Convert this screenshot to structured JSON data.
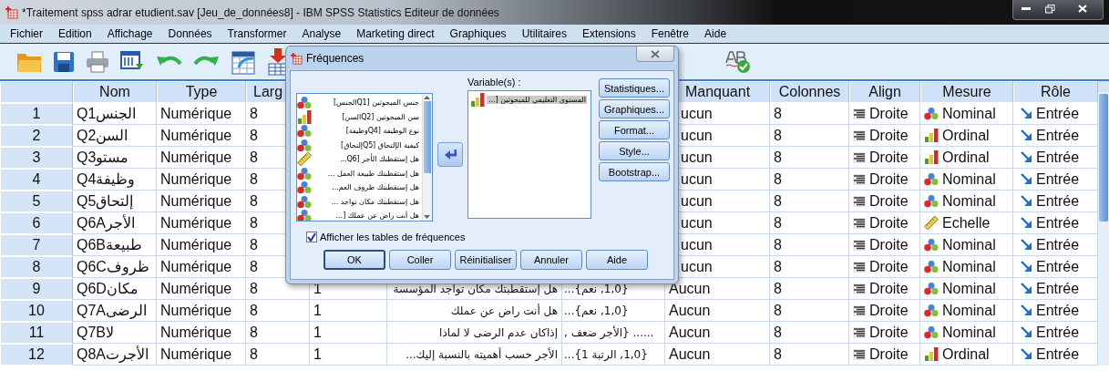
{
  "window": {
    "title": "*Traitement spss adrar etudient.sav [Jeu_de_données8] - IBM SPSS Statistics Editeur de données"
  },
  "menu": [
    "Fichier",
    "Edition",
    "Affichage",
    "Données",
    "Transformer",
    "Analyse",
    "Marketing direct",
    "Graphiques",
    "Utilitaires",
    "Extensions",
    "Fenêtre",
    "Aide"
  ],
  "table": {
    "columns": [
      "Nom",
      "Type",
      "Larg",
      "Manquant",
      "Colonnes",
      "Align",
      "Mesure",
      "Rôle"
    ],
    "rows": [
      {
        "num": "1",
        "nom": "Q1الجنس",
        "type": "Numérique",
        "largeur": "8",
        "manquant": "ucun",
        "colonnes": "8",
        "align": "Droite",
        "mesure": {
          "label": "Nominal",
          "kind": "nominal"
        },
        "role": "Entrée"
      },
      {
        "num": "2",
        "nom": "Q2السن",
        "type": "Numérique",
        "largeur": "8",
        "manquant": "ucun",
        "colonnes": "8",
        "align": "Droite",
        "mesure": {
          "label": "Ordinal",
          "kind": "ordinal"
        },
        "role": "Entrée"
      },
      {
        "num": "3",
        "nom": "Q3مستو",
        "type": "Numérique",
        "largeur": "8",
        "manquant": "ucun",
        "colonnes": "8",
        "align": "Droite",
        "mesure": {
          "label": "Ordinal",
          "kind": "ordinal"
        },
        "role": "Entrée"
      },
      {
        "num": "4",
        "nom": "Q4وظيفة",
        "type": "Numérique",
        "largeur": "8",
        "manquant": "ucun",
        "colonnes": "8",
        "align": "Droite",
        "mesure": {
          "label": "Nominal",
          "kind": "nominal"
        },
        "role": "Entrée"
      },
      {
        "num": "5",
        "nom": "Q5إلتحاق",
        "type": "Numérique",
        "largeur": "8",
        "manquant": "ucun",
        "colonnes": "8",
        "align": "Droite",
        "mesure": {
          "label": "Nominal",
          "kind": "nominal"
        },
        "role": "Entrée"
      },
      {
        "num": "6",
        "nom": "Q6Aالأجر",
        "type": "Numérique",
        "largeur": "8",
        "manquant": "ucun",
        "colonnes": "8",
        "align": "Droite",
        "mesure": {
          "label": "Echelle",
          "kind": "scale"
        },
        "role": "Entrée"
      },
      {
        "num": "7",
        "nom": "Q6Bطبيعة",
        "type": "Numérique",
        "largeur": "8",
        "manquant": "ucun",
        "colonnes": "8",
        "align": "Droite",
        "mesure": {
          "label": "Nominal",
          "kind": "nominal"
        },
        "role": "Entrée"
      },
      {
        "num": "8",
        "nom": "Q6Cظروف",
        "type": "Numérique",
        "largeur": "8",
        "manquant": "ucun",
        "colonnes": "8",
        "align": "Droite",
        "mesure": {
          "label": "Nominal",
          "kind": "nominal"
        },
        "role": "Entrée"
      },
      {
        "num": "9",
        "nom": "Q6Dمكان",
        "type": "Numérique",
        "largeur": "8",
        "decimales": "1",
        "etiquette": "هل إستقطبتك مكان تواجد المؤسسة",
        "valeurs": "{1,0, نعم}...",
        "manquant": "Aucun",
        "colonnes": "8",
        "align": "Droite",
        "mesure": {
          "label": "Nominal",
          "kind": "nominal"
        },
        "role": "Entrée"
      },
      {
        "num": "10",
        "nom": "Q7Aالرضى",
        "type": "Numérique",
        "largeur": "8",
        "decimales": "1",
        "etiquette": "هل أنت راض عن عملك",
        "valeurs": "{1,0, نعم}...",
        "manquant": "Aucun",
        "colonnes": "8",
        "align": "Droite",
        "mesure": {
          "label": "Nominal",
          "kind": "nominal"
        },
        "role": "Entrée"
      },
      {
        "num": "11",
        "nom": "Q7Bلا",
        "type": "Numérique",
        "largeur": "8",
        "decimales": "1",
        "etiquette": "إذاكان عدم الرضى لا لماذا",
        "valeurs": "...... {الأجر ضعف ,",
        "manquant": "Aucun",
        "colonnes": "8",
        "align": "Droite",
        "mesure": {
          "label": "Nominal",
          "kind": "nominal"
        },
        "role": "Entrée"
      },
      {
        "num": "12",
        "nom": "Q8Aالأجرت",
        "type": "Numérique",
        "largeur": "8",
        "decimales": "1",
        "etiquette": "الأجر حسب أهميته بالنسبة إليك...",
        "valeurs": "{1,0, الرتبة 1}...",
        "manquant": "Aucun",
        "colonnes": "8",
        "align": "Droite",
        "mesure": {
          "label": "Ordinal",
          "kind": "ordinal"
        },
        "role": "Entrée"
      }
    ]
  },
  "dialog": {
    "title": "Fréquences",
    "source_list": [
      {
        "label": "جنس المبحوثين [Q1الجنس]",
        "kind": "nominal",
        "selected": false
      },
      {
        "label": "سن المبحوثين [Q2السن]",
        "kind": "ordinal",
        "selected": false
      },
      {
        "label": "نوع الوظيفة [Q4وظيفة]",
        "kind": "nominal",
        "selected": false
      },
      {
        "label": "كيفية الإلتحاق [Q5إلتحاق]",
        "kind": "nominal",
        "selected": false
      },
      {
        "label": "هل إستقطبك الأجر [Q6...",
        "kind": "scale",
        "selected": false
      },
      {
        "label": "هل إستقطبتك طبيعة العمل ...",
        "kind": "nominal",
        "selected": false
      },
      {
        "label": "هل إستقطبتك ظروف العم...",
        "kind": "nominal",
        "selected": false
      },
      {
        "label": "هل إستقطبتك مكان تواجد ...",
        "kind": "nominal",
        "selected": false
      },
      {
        "label": "هل أنت راض عن عملك [...",
        "kind": "nominal",
        "selected": false
      }
    ],
    "target_label": "Variable(s) :",
    "target_list": [
      {
        "label": "المستوى التعليمي للمبحوثين [...",
        "kind": "ordinal",
        "selected": true
      }
    ],
    "side_buttons": [
      "Statistiques...",
      "Graphiques...",
      "Format...",
      "Style...",
      "Bootstrap..."
    ],
    "checkbox": {
      "label": "Afficher les tables de fréquences",
      "checked": true
    },
    "buttons": [
      {
        "label": "OK",
        "default": true
      },
      {
        "label": "Coller",
        "default": false
      },
      {
        "label": "Réinitialiser",
        "default": false
      },
      {
        "label": "Annuler",
        "default": false
      },
      {
        "label": "Aide",
        "default": false
      }
    ]
  }
}
